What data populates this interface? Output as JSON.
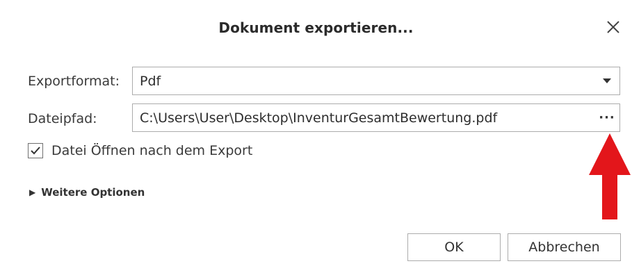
{
  "dialog": {
    "title": "Dokument exportieren...",
    "close_icon": "close-icon"
  },
  "form": {
    "export_format_label": "Exportformat:",
    "export_format_value": "Pdf",
    "file_path_label": "Dateipfad:",
    "file_path_value": "C:\\Users\\User\\Desktop\\InventurGesamtBewertung.pdf",
    "browse_label": "···",
    "open_after_export_label": "Datei Öffnen nach dem Export",
    "open_after_export_checked": true,
    "more_options_label": "Weitere Optionen"
  },
  "buttons": {
    "ok_label": "OK",
    "cancel_label": "Abbrechen"
  },
  "colors": {
    "annotation_arrow": "#e3161b",
    "field_border": "#acacac"
  }
}
